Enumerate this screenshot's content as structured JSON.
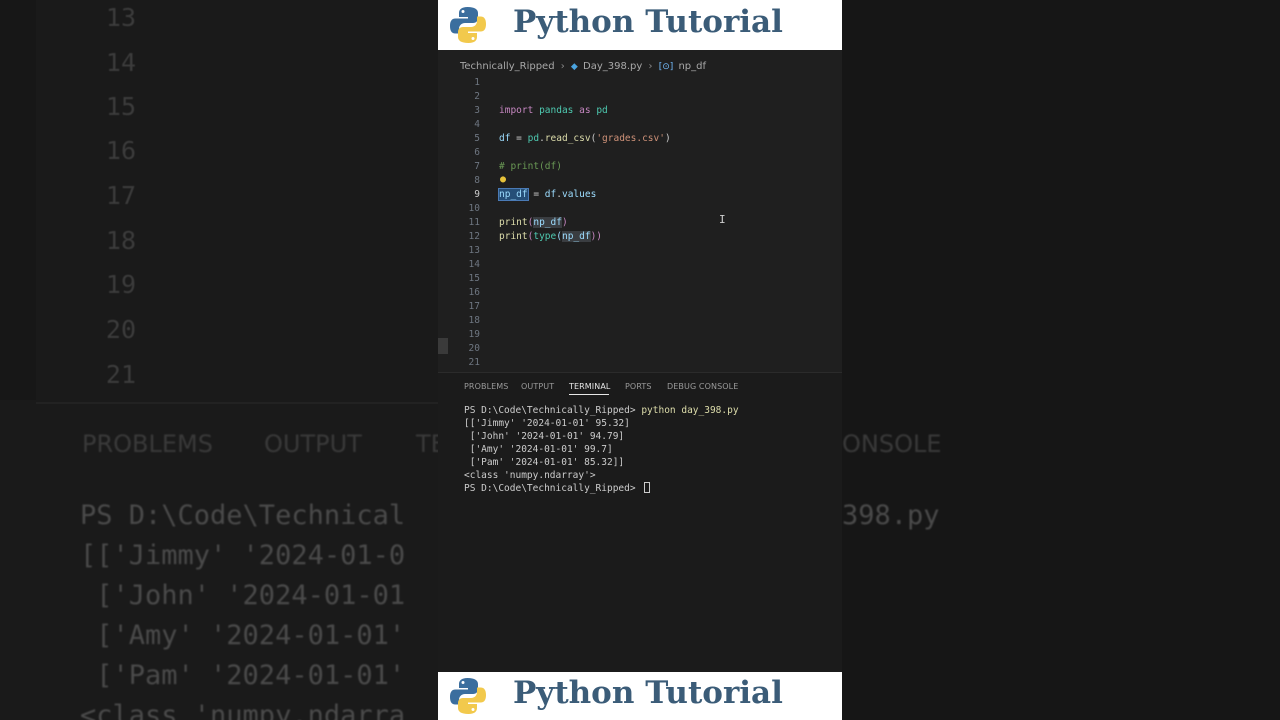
{
  "banner": {
    "title": "Python Tutorial"
  },
  "breadcrumb": {
    "folder": "Technically_Ripped",
    "file": "Day_398.py",
    "symbol": "np_df"
  },
  "editor": {
    "line_numbers": [
      "1",
      "2",
      "3",
      "4",
      "5",
      "6",
      "7",
      "8",
      "9",
      "10",
      "11",
      "12",
      "13",
      "14",
      "15",
      "16",
      "17",
      "18",
      "19",
      "20",
      "21"
    ],
    "active_line": "9",
    "code": {
      "l3_kw1": "import",
      "l3_mod": "pandas",
      "l3_kw2": "as",
      "l3_alias": "pd",
      "l5_var": "df",
      "l5_eq": " = ",
      "l5_mod": "pd",
      "l5_dot": ".",
      "l5_fn": "read_csv",
      "l5_open": "(",
      "l5_str": "'grades.csv'",
      "l5_close": ")",
      "l7_comment": "# print(df)",
      "l9_var": "np_df",
      "l9_eq": " = ",
      "l9_obj": "df",
      "l9_dot": ".",
      "l9_attr": "values",
      "l11_fn": "print",
      "l11_open": "(",
      "l11_arg": "np_df",
      "l11_close": ")",
      "l12_fn": "print",
      "l12_open": "(",
      "l12_type": "type",
      "l12_open2": "(",
      "l12_arg": "np_df",
      "l12_close": "))"
    }
  },
  "panel": {
    "tabs": [
      "PROBLEMS",
      "OUTPUT",
      "TERMINAL",
      "PORTS",
      "DEBUG CONSOLE"
    ],
    "active_tab": "TERMINAL",
    "terminal": {
      "prompt1": "PS D:\\Code\\Technically_Ripped> ",
      "command": "python day_398.py",
      "output": [
        "[['Jimmy' '2024-01-01' 95.32]",
        " ['John' '2024-01-01' 94.79]",
        " ['Amy' '2024-01-01' 99.7]",
        " ['Pam' '2024-01-01' 85.32]]",
        "<class 'numpy.ndarray'>"
      ],
      "prompt2": "PS D:\\Code\\Technically_Ripped> "
    }
  },
  "background": {
    "left_line_numbers": [
      "13",
      "14",
      "15",
      "16",
      "17",
      "18",
      "19",
      "20",
      "21"
    ],
    "left_tabs": [
      "PROBLEMS",
      "OUTPUT",
      "TE"
    ],
    "left_terminal": [
      "PS D:\\Code\\Technical",
      "[['Jimmy' '2024-01-0",
      " ['John' '2024-01-01",
      " ['Amy' '2024-01-01'",
      " ['Pam' '2024-01-01'",
      "<class 'numpy.ndarra"
    ],
    "right_tab": "ONSOLE",
    "right_terminal": "398.py"
  },
  "colors": {
    "banner_text": "#3b5c78",
    "editor_bg": "#1f1f1f",
    "keyword": "#c586c0",
    "string": "#ce9178",
    "comment": "#6a9955"
  },
  "icons": {
    "logo": "python-logo-icon",
    "file": "python-file-icon",
    "symbol": "variable-icon",
    "lightbulb": "lightbulb-icon",
    "text_cursor": "ibeam-cursor-icon"
  }
}
